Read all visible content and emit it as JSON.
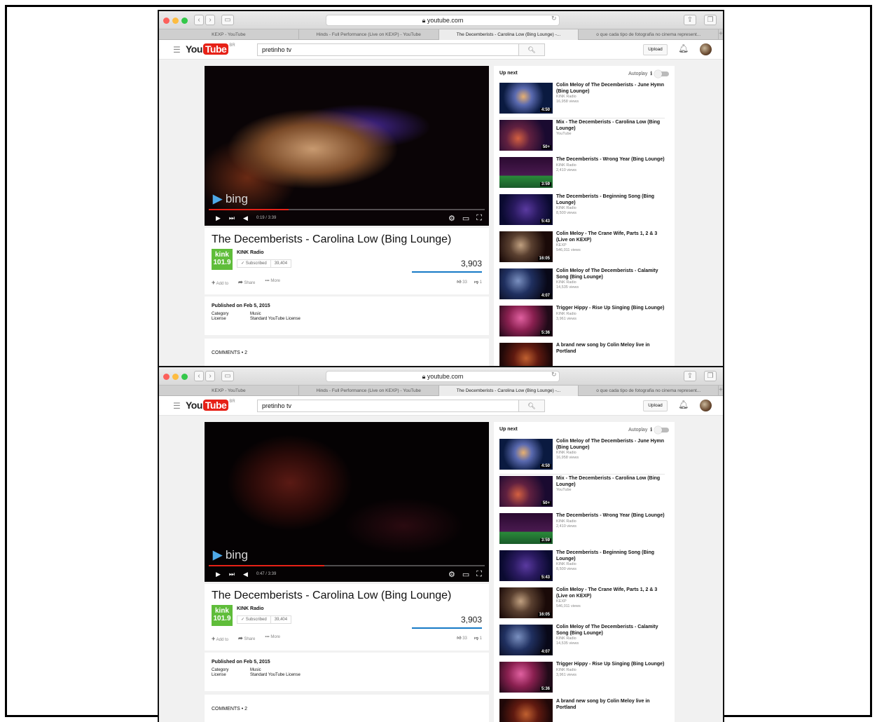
{
  "browser": {
    "address": "youtube.com",
    "tabs": [
      "KEXP - YouTube",
      "Hinds - Full Performance (Live on KEXP) - YouTube",
      "The Decemberists - Carolina Low (Bing Lounge) -...",
      "o que cada tipo de fotografia no cinema represent..."
    ],
    "tabs_bottom_active": "The Decemberists - Carolina Low (Bing Lounge) -..."
  },
  "masthead": {
    "logo_you": "You",
    "logo_tube": "Tube",
    "logo_region": "BR",
    "search_value": "pretinho tv",
    "upload_label": "Upload"
  },
  "video": {
    "title": "The Decemberists - Carolina Low (Bing Lounge)",
    "channel": "KINK Radio",
    "channel_logo": "kink 101.9",
    "subscribed_label": "Subscribed",
    "subscriber_count": "39,404",
    "views": "3,903",
    "add_to": "Add to",
    "share": "Share",
    "more": "More",
    "likes": "33",
    "dislikes": "1",
    "bing_label": "bing",
    "duration": "3:39",
    "published": "Published on Feb 5, 2015",
    "category_label": "Category",
    "category_value": "Music",
    "license_label": "License",
    "license_value": "Standard YouTube License",
    "comments": "COMMENTS • 2"
  },
  "states": {
    "top": {
      "time": "0:19 / 3:39",
      "progress": 0.29
    },
    "bottom": {
      "time": "0:47 / 3:39",
      "progress": 0.42
    }
  },
  "sidebar": {
    "up_next": "Up next",
    "autoplay": "Autoplay",
    "items": [
      {
        "title": "Colin Meloy of The Decemberists - June Hymn (Bing Lounge)",
        "channel": "KINK Radio",
        "views": "16,958 views",
        "duration": "4:50"
      },
      {
        "title": "Mix - The Decemberists - Carolina Low (Bing Lounge)",
        "channel": "YouTube",
        "views": "",
        "duration": "50+"
      },
      {
        "title": "The Decemberists - Wrong Year (Bing Lounge)",
        "channel": "KINK Radio",
        "views": "2,410 views",
        "duration": "3:59"
      },
      {
        "title": "The Decemberists - Beginning Song (Bing Lounge)",
        "channel": "KINK Radio",
        "views": "8,500 views",
        "duration": "5:43"
      },
      {
        "title": "Colin Meloy - The Crane Wife, Parts 1, 2 & 3 (Live on KEXP)",
        "channel": "KEXP",
        "views": "546,011 views",
        "duration": "16:05"
      },
      {
        "title": "Colin Meloy of The Decemberists - Calamity Song (Bing Lounge)",
        "channel": "KINK Radio",
        "views": "14,535 views",
        "duration": "4:07"
      },
      {
        "title": "Trigger Hippy - Rise Up Singing (Bing Lounge)",
        "channel": "KINK Radio",
        "views": "3,961 views",
        "duration": "5:36"
      },
      {
        "title": "A brand new song by Colin Meloy live in Portland",
        "channel": "",
        "views": "",
        "duration": ""
      }
    ]
  },
  "colors": {
    "brand_red": "#e62117",
    "link_blue": "#167ac6",
    "kink_green": "#5fbd3a"
  }
}
